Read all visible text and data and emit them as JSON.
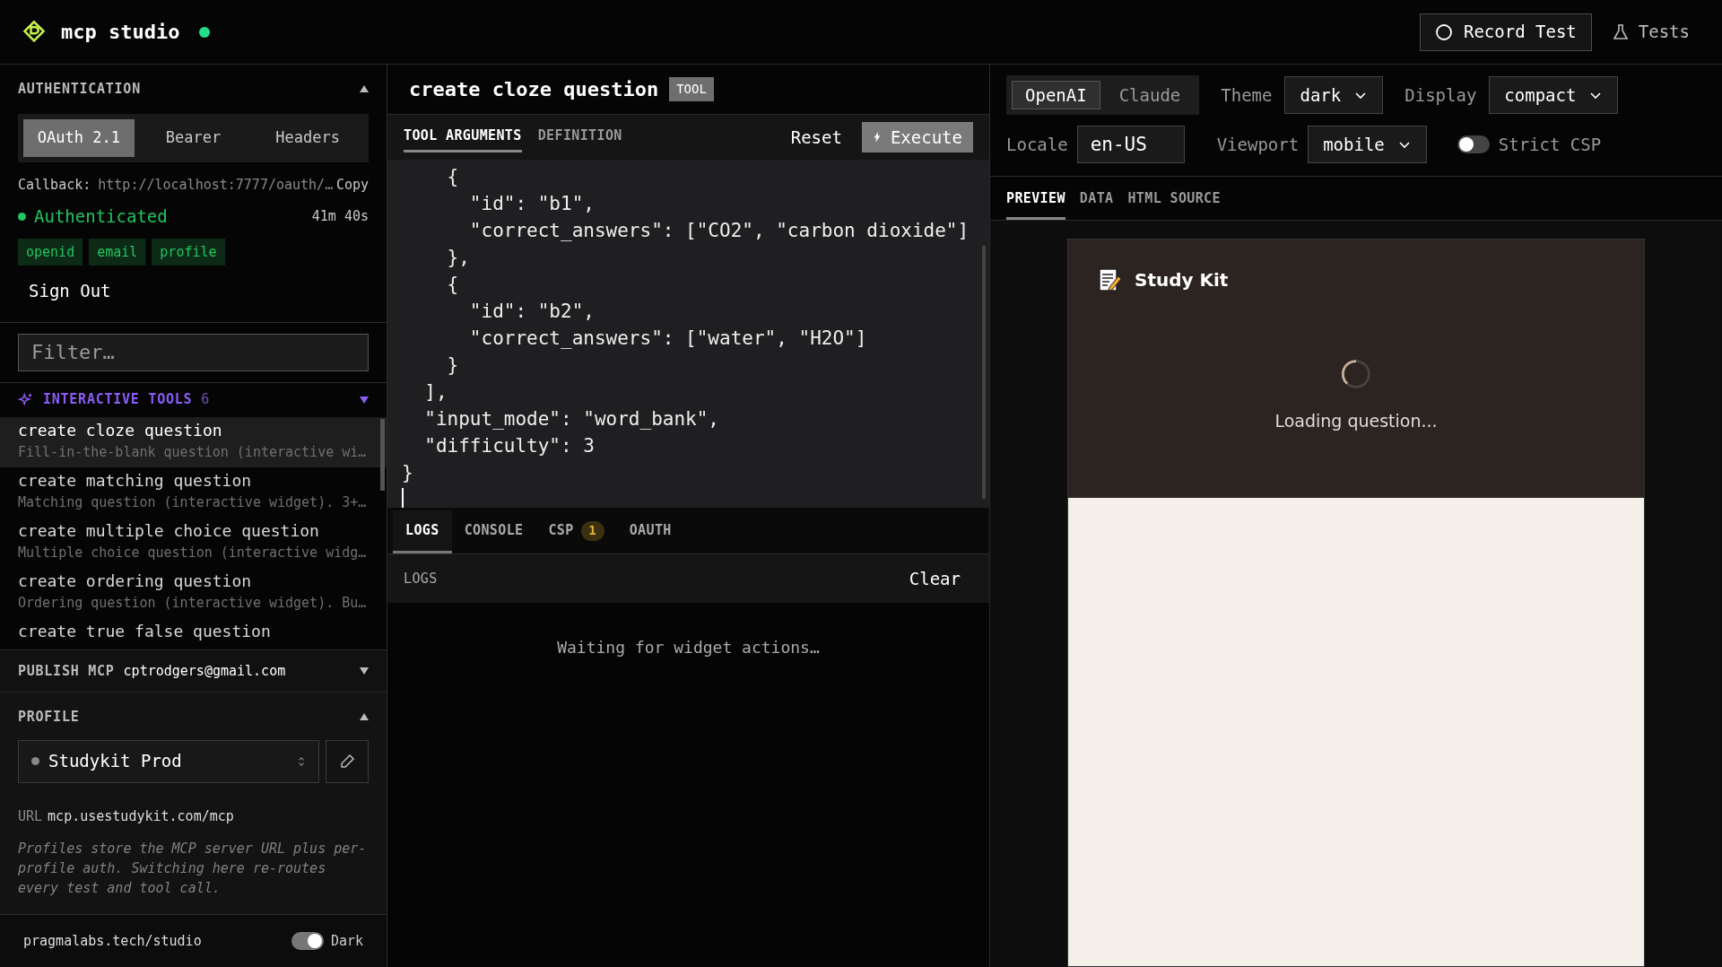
{
  "header": {
    "app_name": "mcp studio",
    "connected": true,
    "record_button": "Record Test",
    "tests_button": "Tests"
  },
  "sidebar": {
    "auth": {
      "title": "AUTHENTICATION",
      "expanded": true,
      "tabs": [
        {
          "label": "OAuth 2.1",
          "selected": true
        },
        {
          "label": "Bearer",
          "selected": false
        },
        {
          "label": "Headers",
          "selected": false
        }
      ],
      "callback_label": "Callback:",
      "callback_url": "http://localhost:7777/oauth/…",
      "copy": "Copy",
      "status": "Authenticated",
      "expires": "41m 40s",
      "scopes": [
        "openid",
        "email",
        "profile"
      ],
      "sign_out": "Sign Out"
    },
    "filter": {
      "placeholder": "Filter…"
    },
    "tools": {
      "title": "INTERACTIVE TOOLS",
      "count": "6",
      "expanded": true,
      "items": [
        {
          "name": "create cloze question",
          "description": "Fill-in-the-blank question (interactive wi…",
          "selected": true
        },
        {
          "name": "create matching question",
          "description": "Matching question (interactive widget). 3+…",
          "selected": false
        },
        {
          "name": "create multiple choice question",
          "description": "Multiple choice question (interactive widg…",
          "selected": false
        },
        {
          "name": "create ordering question",
          "description": "Ordering question (interactive widget). Bu…",
          "selected": false
        },
        {
          "name": "create true false question",
          "selected": false
        }
      ]
    },
    "publish": {
      "title": "PUBLISH MCP",
      "email": "cptrodgers@gmail.com",
      "expanded": false
    },
    "profile": {
      "title": "PROFILE",
      "expanded": true,
      "selected_profile": "Studykit Prod",
      "url_label": "URL",
      "url": "mcp.usestudykit.com/mcp",
      "note": "Profiles store the MCP server URL plus per-profile auth. Switching here re-routes every test and tool call."
    },
    "footer": {
      "link": "pragmalabs.tech/studio",
      "dark_mode": true,
      "dark_label": "Dark"
    }
  },
  "editor": {
    "title": "create cloze question",
    "badge": "TOOL",
    "tabs": [
      {
        "label": "TOOL ARGUMENTS",
        "selected": true
      },
      {
        "label": "DEFINITION",
        "selected": false
      }
    ],
    "reset": "Reset",
    "execute": "Execute",
    "code_lines": [
      "    {",
      "      \"id\": \"b1\",",
      "      \"correct_answers\": [\"CO2\", \"carbon dioxide\"]",
      "    },",
      "    {",
      "      \"id\": \"b2\",",
      "      \"correct_answers\": [\"water\", \"H2O\"]",
      "    }",
      "  ],",
      "  \"input_mode\": \"word_bank\",",
      "  \"difficulty\": 3",
      "}"
    ]
  },
  "bottom_panel": {
    "tabs": [
      {
        "label": "LOGS",
        "selected": true
      },
      {
        "label": "CONSOLE",
        "selected": false
      },
      {
        "label": "CSP",
        "badge": "1",
        "selected": false
      },
      {
        "label": "OAUTH",
        "selected": false
      }
    ],
    "title": "LOGS",
    "clear": "Clear",
    "empty_message": "Waiting for widget actions…"
  },
  "preview_panel": {
    "hosts": [
      {
        "label": "OpenAI",
        "selected": true
      },
      {
        "label": "Claude",
        "selected": false
      }
    ],
    "theme_label": "Theme",
    "theme": "dark",
    "display_label": "Display",
    "display": "compact",
    "locale_label": "Locale",
    "locale": "en-US",
    "viewport_label": "Viewport",
    "viewport": "mobile",
    "strict_csp": false,
    "strict_csp_label": "Strict CSP",
    "tabs": [
      {
        "label": "PREVIEW",
        "selected": true
      },
      {
        "label": "DATA",
        "selected": false
      },
      {
        "label": "HTML SOURCE",
        "selected": false
      }
    ],
    "widget": {
      "title": "Study Kit",
      "loading": "Loading question..."
    }
  }
}
